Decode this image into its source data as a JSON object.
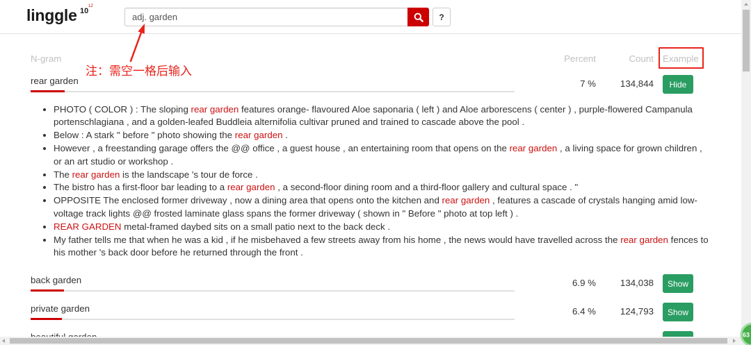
{
  "logo": {
    "text": "linggle",
    "sup": "10",
    "tiny": "12"
  },
  "search": {
    "value": "adj. garden",
    "icon": "search-icon",
    "help_label": "?"
  },
  "columns": {
    "ngram": "N-gram",
    "percent": "Percent",
    "count": "Count",
    "example": "Example"
  },
  "results": [
    {
      "ngram": "rear garden",
      "percent": "7 %",
      "count": "134,844",
      "button": "Hide",
      "examples": [
        [
          {
            "t": "PHOTO ( COLOR ) : The sloping "
          },
          {
            "t": "rear garden",
            "hl": true
          },
          {
            "t": " features orange- flavoured Aloe saponaria ( left ) and Aloe arborescens ( center ) , purple-flowered Campanula portenschlagiana , and a golden-leafed Buddleia alternifolia cultivar pruned and trained to cascade above the pool ."
          }
        ],
        [
          {
            "t": "Below : A stark \" before \" photo showing the "
          },
          {
            "t": "rear garden",
            "hl": true
          },
          {
            "t": " ."
          }
        ],
        [
          {
            "t": "However , a freestanding garage offers the @@ office , a guest house , an entertaining room that opens on the "
          },
          {
            "t": "rear garden",
            "hl": true
          },
          {
            "t": " , a living space for grown children , or an art studio or workshop ."
          }
        ],
        [
          {
            "t": "The "
          },
          {
            "t": "rear garden",
            "hl": true
          },
          {
            "t": " is the landscape 's tour de force ."
          }
        ],
        [
          {
            "t": "The bistro has a first-floor bar leading to a "
          },
          {
            "t": "rear garden",
            "hl": true
          },
          {
            "t": " , a second-floor dining room and a third-floor gallery and cultural space . \""
          }
        ],
        [
          {
            "t": "OPPOSITE The enclosed former driveway , now a dining area that opens onto the kitchen and "
          },
          {
            "t": "rear garden",
            "hl": true
          },
          {
            "t": " , features a cascade of crystals hanging amid low-voltage track lights @@ frosted laminate glass spans the former driveway ( shown in \" Before \" photo at top left ) ."
          }
        ],
        [
          {
            "t": "REAR GARDEN",
            "hl": true
          },
          {
            "t": " metal-framed daybed sits on a small patio next to the back deck ."
          }
        ],
        [
          {
            "t": "My father tells me that when he was a kid , if he misbehaved a few streets away from his home , the news would have travelled across the "
          },
          {
            "t": "rear garden",
            "hl": true
          },
          {
            "t": " fences to his mother 's back door before he returned through the front ."
          }
        ]
      ]
    },
    {
      "ngram": "back garden",
      "percent": "6.9 %",
      "count": "134,038",
      "button": "Show"
    },
    {
      "ngram": "private garden",
      "percent": "6.4 %",
      "count": "124,793",
      "button": "Show"
    },
    {
      "ngram": "beautiful garden"
    }
  ],
  "annotation": {
    "note": "注：需空一格后输入"
  },
  "floating_badge": {
    "text": "63"
  },
  "colors": {
    "accent_red": "#cc0000",
    "button_green": "#2a9d62",
    "highlight_red": "#cc1111",
    "annotation_red": "#e8231b"
  }
}
